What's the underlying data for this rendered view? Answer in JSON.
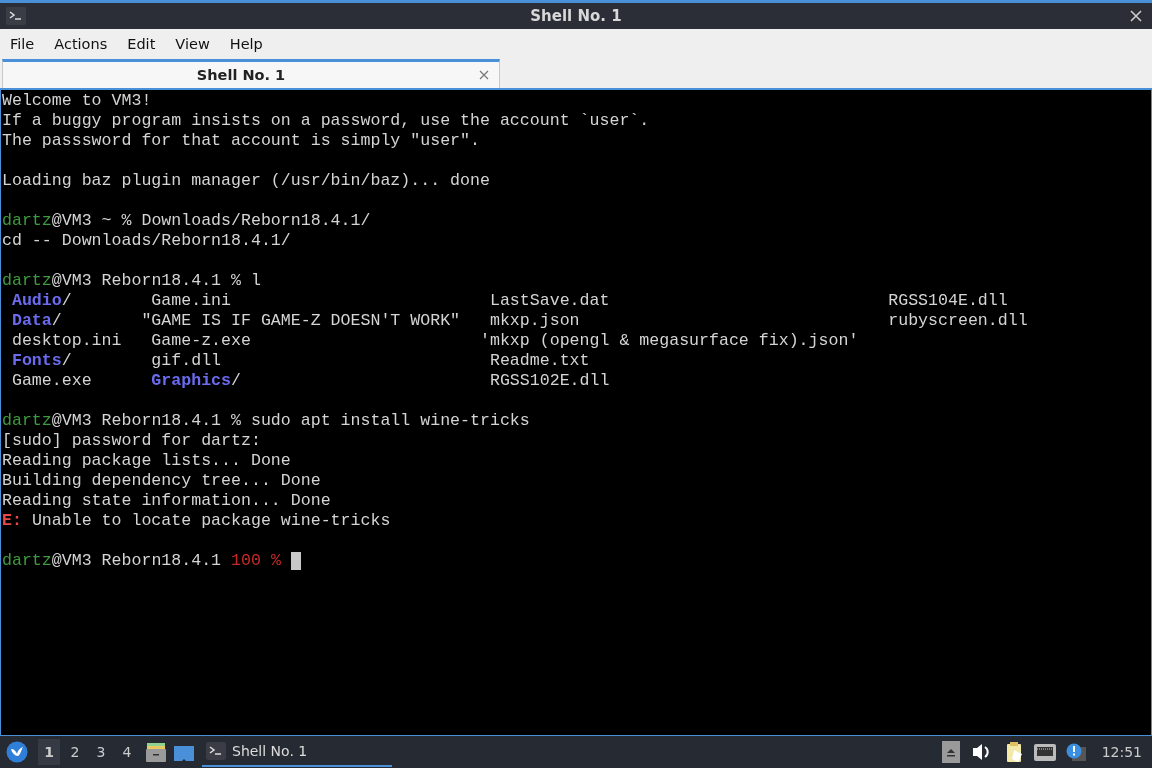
{
  "window": {
    "title": "Shell No. 1"
  },
  "menu": [
    "File",
    "Actions",
    "Edit",
    "View",
    "Help"
  ],
  "tabs": [
    {
      "label": "Shell No. 1",
      "selected": true
    }
  ],
  "terminal": {
    "lines": [
      {
        "kind": "text",
        "segments": [
          {
            "text": "Welcome to VM3!",
            "kind": "plain"
          }
        ]
      },
      {
        "kind": "text",
        "segments": [
          {
            "text": "If a buggy program insists on a password, use the account `user`.",
            "kind": "plain"
          }
        ]
      },
      {
        "kind": "text",
        "segments": [
          {
            "text": "The passsword for that account is simply \"user\".",
            "kind": "plain"
          }
        ]
      },
      {
        "kind": "blank"
      },
      {
        "kind": "text",
        "segments": [
          {
            "text": "Loading baz plugin manager (/usr/bin/baz)... done",
            "kind": "plain"
          }
        ]
      },
      {
        "kind": "blank"
      },
      {
        "kind": "text",
        "segments": [
          {
            "text": "dartz",
            "kind": "user"
          },
          {
            "text": "@VM3 ~ % Downloads/Reborn18.4.1/",
            "kind": "plain"
          }
        ]
      },
      {
        "kind": "text",
        "segments": [
          {
            "text": "cd -- Downloads/Reborn18.4.1/",
            "kind": "plain"
          }
        ]
      },
      {
        "kind": "blank"
      },
      {
        "kind": "text",
        "segments": [
          {
            "text": "dartz",
            "kind": "user"
          },
          {
            "text": "@VM3 Reborn18.4.1 % l",
            "kind": "plain"
          }
        ]
      },
      {
        "kind": "listing",
        "rows": [
          [
            {
              "name": "Audio",
              "suffix": "/",
              "kind": "dir"
            },
            {
              "name": "Game.ini",
              "kind": "file"
            },
            {
              "name": "LastSave.dat",
              "kind": "file"
            },
            {
              "name": "RGSS104E.dll",
              "kind": "file"
            }
          ],
          [
            {
              "name": "Data",
              "suffix": "/",
              "kind": "dir"
            },
            {
              "name": "\"GAME IS IF GAME-Z DOESN'T WORK\"",
              "kind": "quoted"
            },
            {
              "name": "mkxp.json",
              "kind": "file"
            },
            {
              "name": "rubyscreen.dll",
              "kind": "file"
            }
          ],
          [
            {
              "name": "desktop.ini",
              "kind": "file"
            },
            {
              "name": "Game-z.exe",
              "kind": "file"
            },
            {
              "name": "'mkxp (opengl & megasurface fix).json'",
              "kind": "quoted"
            }
          ],
          [
            {
              "name": "Fonts",
              "suffix": "/",
              "kind": "dir"
            },
            {
              "name": "gif.dll",
              "kind": "file"
            },
            {
              "name": "Readme.txt",
              "kind": "file"
            }
          ],
          [
            {
              "name": "Game.exe",
              "kind": "file"
            },
            {
              "name": "Graphics",
              "suffix": "/",
              "kind": "dir"
            },
            {
              "name": "RGSS102E.dll",
              "kind": "file"
            }
          ]
        ]
      },
      {
        "kind": "blank"
      },
      {
        "kind": "text",
        "segments": [
          {
            "text": "dartz",
            "kind": "user"
          },
          {
            "text": "@VM3 Reborn18.4.1 % sudo apt install wine-tricks",
            "kind": "plain"
          }
        ]
      },
      {
        "kind": "text",
        "segments": [
          {
            "text": "[sudo] password for dartz:",
            "kind": "plain"
          }
        ]
      },
      {
        "kind": "text",
        "segments": [
          {
            "text": "Reading package lists... Done",
            "kind": "plain"
          }
        ]
      },
      {
        "kind": "text",
        "segments": [
          {
            "text": "Building dependency tree... Done",
            "kind": "plain"
          }
        ]
      },
      {
        "kind": "text",
        "segments": [
          {
            "text": "Reading state information... Done",
            "kind": "plain"
          }
        ]
      },
      {
        "kind": "text",
        "segments": [
          {
            "text": "E:",
            "kind": "error"
          },
          {
            "text": "Unable to locate package wine-tricks",
            "kind": "plain",
            "spaced": true
          }
        ]
      },
      {
        "kind": "blank"
      },
      {
        "kind": "text",
        "cursor": true,
        "segments": [
          {
            "text": "dartz",
            "kind": "user"
          },
          {
            "text": "@VM3 Reborn18.4.1",
            "kind": "plain"
          },
          {
            "text": "100 %",
            "kind": "status",
            "spaced": true
          }
        ]
      }
    ]
  },
  "taskbar": {
    "desktops": [
      {
        "label": "1",
        "selected": true
      },
      {
        "label": "2",
        "selected": false
      },
      {
        "label": "3",
        "selected": false
      },
      {
        "label": "4",
        "selected": false
      }
    ],
    "tasks": [
      {
        "label": "Shell No. 1",
        "selected": true
      }
    ],
    "clock": "12:51"
  }
}
